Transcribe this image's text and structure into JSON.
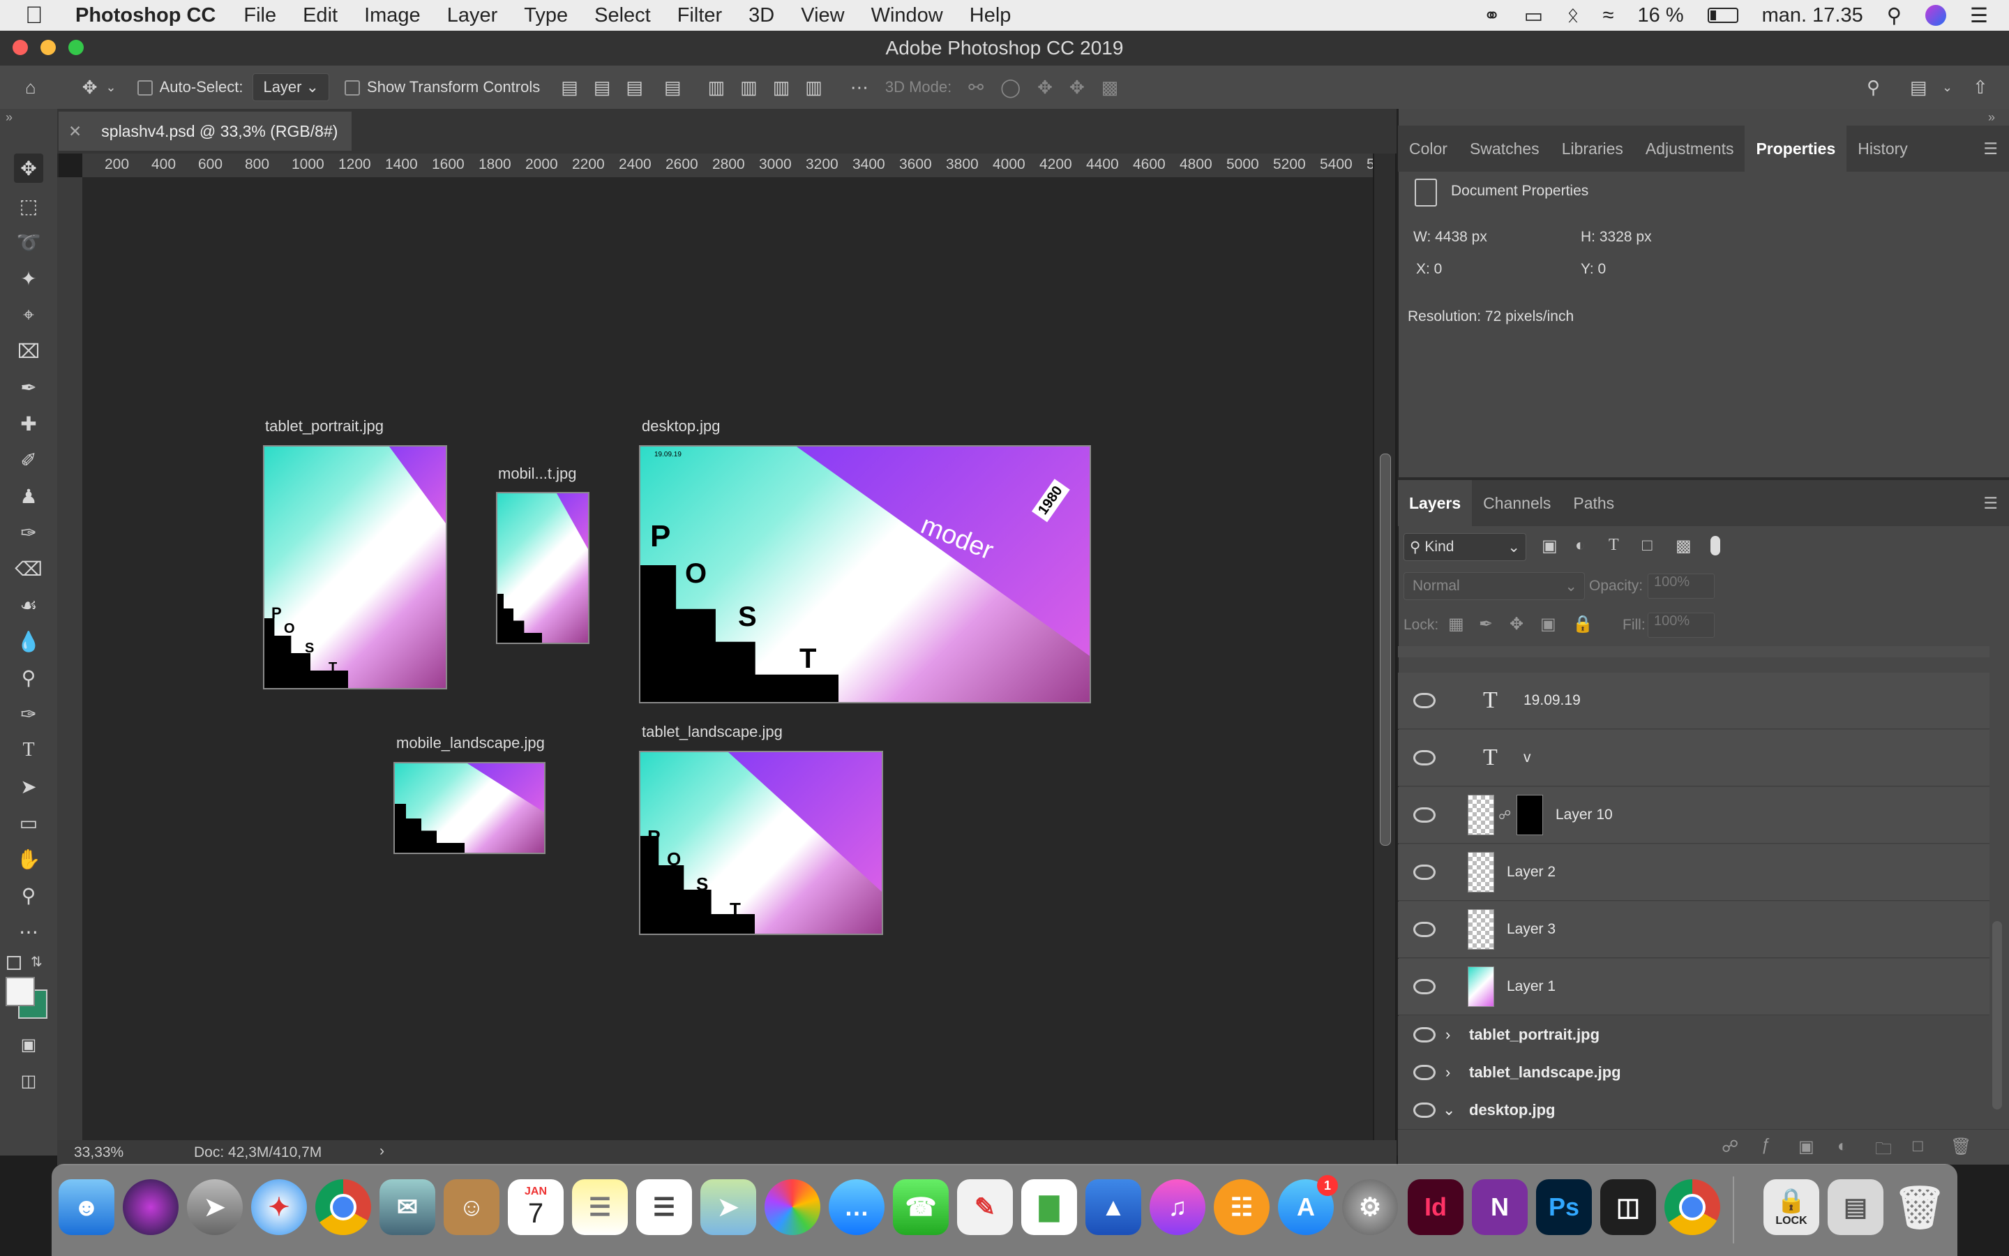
{
  "menubar": {
    "app_name": "Photoshop CC",
    "items": [
      "File",
      "Edit",
      "Image",
      "Layer",
      "Type",
      "Select",
      "Filter",
      "3D",
      "View",
      "Window",
      "Help"
    ],
    "battery": "16 %",
    "clock": "man. 17.35"
  },
  "window": {
    "title": "Adobe Photoshop CC 2019"
  },
  "options": {
    "auto_select_label": "Auto-Select:",
    "auto_select_value": "Layer",
    "show_transform_label": "Show Transform Controls",
    "mode_3d_label": "3D Mode:"
  },
  "document": {
    "tab_title": "splashv4.psd @ 33,3% (RGB/8#)",
    "ruler_ticks": [
      "200",
      "400",
      "600",
      "800",
      "1000",
      "1200",
      "1400",
      "1600",
      "1800",
      "2000",
      "2200",
      "2400",
      "2600",
      "2800",
      "3000",
      "3200",
      "3400",
      "3600",
      "3800",
      "4000",
      "4200",
      "4400",
      "4600",
      "4800",
      "5000",
      "5200",
      "5400",
      "5"
    ]
  },
  "artboards": [
    {
      "label": "tablet_portrait.jpg"
    },
    {
      "label": "mobil...t.jpg"
    },
    {
      "label": "desktop.jpg"
    },
    {
      "label": "mobile_landscape.jpg"
    },
    {
      "label": "tablet_landscape.jpg"
    }
  ],
  "artwork_text": {
    "letters": [
      "P",
      "O",
      "S",
      "T"
    ],
    "word": "moder",
    "year": "1980",
    "date": "19.09.19"
  },
  "status": {
    "zoom": "33,33%",
    "doc": "Doc: 42,3M/410,7M"
  },
  "properties_panel": {
    "tabs": [
      "Color",
      "Swatches",
      "Libraries",
      "Adjustments",
      "Properties",
      "History"
    ],
    "active_tab": "Properties",
    "title": "Document Properties",
    "width": "W: 4438 px",
    "height": "H: 3328 px",
    "x": "X: 0",
    "y": "Y: 0",
    "resolution": "Resolution: 72 pixels/inch"
  },
  "layers_panel": {
    "tabs": [
      "Layers",
      "Channels",
      "Paths"
    ],
    "active_tab": "Layers",
    "filter_kind": "Kind",
    "blend_mode": "Normal",
    "opacity_label": "Opacity:",
    "opacity_value": "100%",
    "lock_label": "Lock:",
    "fill_label": "Fill:",
    "fill_value": "100%",
    "layers": [
      "19.09.19",
      "v",
      "Layer 10",
      "Layer 2",
      "Layer 3",
      "Layer 1"
    ],
    "groups": [
      "tablet_portrait.jpg",
      "tablet_landscape.jpg",
      "desktop.jpg"
    ]
  },
  "dock": {
    "calendar_month": "JAN",
    "calendar_day": "7",
    "appstore_badge": "1",
    "lock_label": "LOCK"
  },
  "colors": {
    "accent": "#2ddcc8",
    "purple": "#a54ee8",
    "panel": "#484848",
    "canvas": "#282828"
  }
}
